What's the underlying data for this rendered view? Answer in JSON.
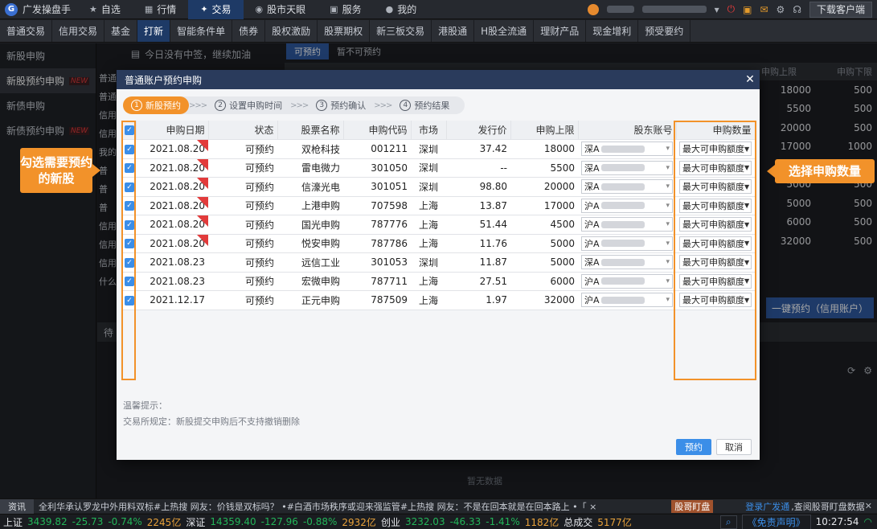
{
  "topbar": {
    "logo": "广发操盘手",
    "nav": [
      {
        "label": "自选",
        "icon": "star-icon"
      },
      {
        "label": "行情",
        "icon": "chart-icon"
      },
      {
        "label": "交易",
        "icon": "trade-icon",
        "active": true
      },
      {
        "label": "股市天眼",
        "icon": "eye-icon"
      },
      {
        "label": "服务",
        "icon": "briefcase-icon"
      },
      {
        "label": "我的",
        "icon": "user-icon"
      }
    ],
    "download": "下载客户端"
  },
  "subtabs": [
    "普通交易",
    "信用交易",
    "基金",
    "打新",
    "智能条件单",
    "债券",
    "股权激励",
    "股票期权",
    "新三板交易",
    "港股通",
    "H股全流通",
    "理财产品",
    "现金增利",
    "预受要约"
  ],
  "subtabs_active": "打新",
  "sidebar": [
    {
      "label": "新股申购",
      "new": false,
      "active": false
    },
    {
      "label": "新股预约申购",
      "new": true,
      "active": true
    },
    {
      "label": "新债申购",
      "new": false,
      "active": false
    },
    {
      "label": "新债预约申购",
      "new": true,
      "active": false
    }
  ],
  "new_badge": "NEW",
  "background": {
    "notice": "今日没有中签，继续加油",
    "tabs": [
      "可预约",
      "暂不可预约"
    ],
    "head_cols": [
      "申购上限",
      "申购下限"
    ],
    "rows": [
      [
        "18000",
        "500"
      ],
      [
        "5500",
        "500"
      ],
      [
        "20000",
        "500"
      ],
      [
        "17000",
        "1000"
      ],
      [
        "45",
        "500"
      ],
      [
        "5000",
        "500"
      ],
      [
        "5000",
        "500"
      ],
      [
        "6000",
        "500"
      ],
      [
        "32000",
        "500"
      ]
    ],
    "left_labels": [
      "普通",
      "普通",
      "信用",
      "信用",
      "我的",
      "普",
      "普",
      "普",
      "信用",
      "信用",
      "信用",
      "什么"
    ],
    "oneclick": "一键预约（信用账户）",
    "lower_label": "待",
    "nodata": "暂无数据"
  },
  "modal": {
    "title": "普通账户预约申购",
    "steps": [
      {
        "num": "1",
        "label": "新股预约",
        "active": true
      },
      {
        "num": "2",
        "label": "设置申购时间",
        "active": false
      },
      {
        "num": "3",
        "label": "预约确认",
        "active": false
      },
      {
        "num": "4",
        "label": "预约结果",
        "active": false
      }
    ],
    "step_sep": ">>>",
    "columns": [
      "申购日期",
      "状态",
      "股票名称",
      "申购代码",
      "市场",
      "发行价",
      "申购上限",
      "股东账号",
      "申购数量"
    ],
    "rows": [
      {
        "date": "2021.08.20",
        "tag": true,
        "status": "可预约",
        "name": "双枪科技",
        "code": "001211",
        "market": "深圳",
        "price": "37.42",
        "limit": "18000",
        "acct": "深A",
        "qty": "最大可申购额度"
      },
      {
        "date": "2021.08.20",
        "tag": true,
        "status": "可预约",
        "name": "雷电微力",
        "code": "301050",
        "market": "深圳",
        "price": "--",
        "limit": "5500",
        "acct": "深A",
        "qty": "最大可申购额度"
      },
      {
        "date": "2021.08.20",
        "tag": true,
        "status": "可预约",
        "name": "信濠光电",
        "code": "301051",
        "market": "深圳",
        "price": "98.80",
        "limit": "20000",
        "acct": "深A",
        "qty": "最大可申购额度"
      },
      {
        "date": "2021.08.20",
        "tag": true,
        "status": "可预约",
        "name": "上港申购",
        "code": "707598",
        "market": "上海",
        "price": "13.87",
        "limit": "17000",
        "acct": "沪A",
        "qty": "最大可申购额度"
      },
      {
        "date": "2021.08.20",
        "tag": true,
        "status": "可预约",
        "name": "国光申购",
        "code": "787776",
        "market": "上海",
        "price": "51.44",
        "limit": "4500",
        "acct": "沪A",
        "qty": "最大可申购额度"
      },
      {
        "date": "2021.08.20",
        "tag": true,
        "status": "可预约",
        "name": "悦安申购",
        "code": "787786",
        "market": "上海",
        "price": "11.76",
        "limit": "5000",
        "acct": "沪A",
        "qty": "最大可申购额度"
      },
      {
        "date": "2021.08.23",
        "tag": false,
        "status": "可预约",
        "name": "远信工业",
        "code": "301053",
        "market": "深圳",
        "price": "11.87",
        "limit": "5000",
        "acct": "深A",
        "qty": "最大可申购额度"
      },
      {
        "date": "2021.08.23",
        "tag": false,
        "status": "可预约",
        "name": "宏微申购",
        "code": "787711",
        "market": "上海",
        "price": "27.51",
        "limit": "6000",
        "acct": "沪A",
        "qty": "最大可申购额度"
      },
      {
        "date": "2021.12.17",
        "tag": false,
        "status": "可预约",
        "name": "正元申购",
        "code": "787509",
        "market": "上海",
        "price": "1.97",
        "limit": "32000",
        "acct": "沪A",
        "qty": "最大可申购额度"
      }
    ],
    "tips_title": "温馨提示：",
    "tips_body": "交易所规定：新股提交申购后不支持撤销删除",
    "ok": "预约",
    "cancel": "取消"
  },
  "callouts": {
    "left": "勾选需要预约的新股",
    "right": "选择申购数量"
  },
  "ticker": {
    "label": "资讯",
    "text": "全利华承认罗龙中外用料双标#上热搜 网友：价钱是双标吗？   •#白酒市场秩序或迎来强监管#上热搜 网友：不是在回本就是在回本路上   •「 ×",
    "hot": "股哥盯盘",
    "login": "登录广发通",
    "login_tail": ",查阅股哥盯盘数据"
  },
  "status": {
    "sh_label": "上证",
    "sh_val": "3439.82",
    "sh_chg": "-25.73",
    "sh_pct": "-0.74%",
    "sh_amt": "2245亿",
    "sz_label": "深证",
    "sz_val": "14359.40",
    "sz_chg": "-127.96",
    "sz_pct": "-0.88%",
    "sz_amt": "2932亿",
    "cy_label": "创业",
    "cy_val": "3232.03",
    "cy_chg": "-46.33",
    "cy_pct": "-1.41%",
    "cy_amt": "1182亿",
    "total_label": "总成交",
    "total_amt": "5177亿",
    "disclaimer": "《免责声明》",
    "time": "10:27:54"
  },
  "colors": {
    "accent": "#f2922a",
    "primary": "#3b8ee8",
    "down": "#22b559",
    "brand": "#1e3a66"
  }
}
